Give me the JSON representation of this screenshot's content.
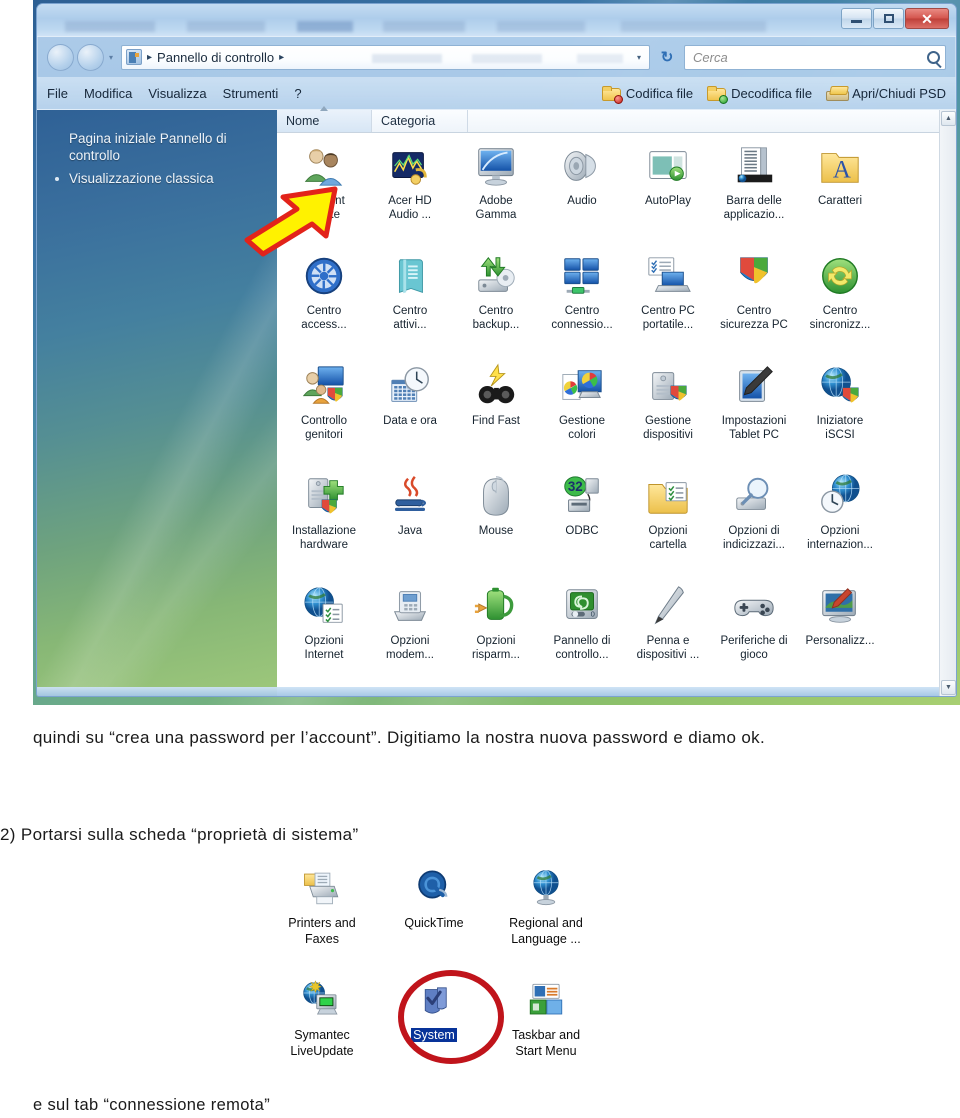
{
  "document": {
    "paragraph_1": "quindi su “crea una password per l’account”. Digitiamo la nostra nuova password e diamo ok.",
    "paragraph_2": "2) Portarsi sulla scheda “proprietà di sistema”",
    "paragraph_3": "e sul tab “connessione remota”"
  },
  "control_panel_window": {
    "window_buttons": {
      "minimize": "—",
      "maximize": "□",
      "close": "✕"
    },
    "address_bar": {
      "breadcrumb_root": "Pannello di controllo",
      "separator": "▸",
      "dropdown_caret": "▾",
      "refresh_label": "↻"
    },
    "search": {
      "placeholder": "Cerca"
    },
    "menu_items": [
      "File",
      "Modifica",
      "Visualizza",
      "Strumenti",
      "?"
    ],
    "toolbar_buttons": [
      {
        "label": "Codifica file",
        "icon": "folder-red-dot-icon"
      },
      {
        "label": "Decodifica file",
        "icon": "folder-green-dot-icon"
      },
      {
        "label": "Apri/Chiudi PSD",
        "icon": "psd-file-icon"
      }
    ],
    "nav_pane": {
      "links": [
        {
          "label": "Pagina iniziale Pannello di controllo",
          "bulleted": false
        },
        {
          "label": "Visualizzazione classica",
          "bulleted": true
        }
      ]
    },
    "columns": [
      {
        "label": "Nome",
        "sorted": true
      },
      {
        "label": "Categoria",
        "sorted": false
      }
    ],
    "items": [
      {
        "label": "Account\nutente",
        "icon": "user-accounts-icon"
      },
      {
        "label": "Acer HD\nAudio ...",
        "icon": "acer-hd-audio-icon"
      },
      {
        "label": "Adobe\nGamma",
        "icon": "adobe-gamma-icon"
      },
      {
        "label": "Audio",
        "icon": "speaker-icon"
      },
      {
        "label": "AutoPlay",
        "icon": "autoplay-icon"
      },
      {
        "label": "Barra delle\napplicazio...",
        "icon": "taskbar-icon"
      },
      {
        "label": "Caratteri",
        "icon": "fonts-folder-icon"
      },
      {
        "label": "Centro\naccess...",
        "icon": "ease-of-access-icon"
      },
      {
        "label": "Centro\nattivi...",
        "icon": "welcome-center-icon"
      },
      {
        "label": "Centro\nbackup...",
        "icon": "backup-center-icon"
      },
      {
        "label": "Centro\nconnessio...",
        "icon": "network-center-icon"
      },
      {
        "label": "Centro PC\nportatile...",
        "icon": "mobility-center-icon"
      },
      {
        "label": "Centro\nsicurezza PC",
        "icon": "security-shield-icon"
      },
      {
        "label": "Centro\nsincronizz...",
        "icon": "sync-center-icon"
      },
      {
        "label": "Controllo\ngenitori",
        "icon": "parental-controls-icon"
      },
      {
        "label": "Data e ora",
        "icon": "date-time-icon"
      },
      {
        "label": "Find Fast",
        "icon": "find-fast-icon"
      },
      {
        "label": "Gestione\ncolori",
        "icon": "color-management-icon"
      },
      {
        "label": "Gestione\ndispositivi",
        "icon": "device-manager-icon"
      },
      {
        "label": "Impostazioni\nTablet PC",
        "icon": "tablet-pc-icon"
      },
      {
        "label": "Iniziatore\niSCSI",
        "icon": "iscsi-initiator-icon"
      },
      {
        "label": "Installazione\nhardware",
        "icon": "add-hardware-icon"
      },
      {
        "label": "Java",
        "icon": "java-icon"
      },
      {
        "label": "Mouse",
        "icon": "mouse-icon"
      },
      {
        "label": "ODBC",
        "icon": "odbc-icon"
      },
      {
        "label": "Opzioni\ncartella",
        "icon": "folder-options-icon"
      },
      {
        "label": "Opzioni di\nindicizzazi...",
        "icon": "indexing-options-icon"
      },
      {
        "label": "Opzioni\ninternazion...",
        "icon": "regional-options-icon"
      },
      {
        "label": "Opzioni\nInternet",
        "icon": "internet-options-icon"
      },
      {
        "label": "Opzioni\nmodem...",
        "icon": "modem-options-icon"
      },
      {
        "label": "Opzioni\nrisparm...",
        "icon": "power-options-icon"
      },
      {
        "label": "Pannello di\ncontrollo...",
        "icon": "nvidia-control-panel-icon"
      },
      {
        "label": "Penna e\ndispositivi ...",
        "icon": "pen-input-icon"
      },
      {
        "label": "Periferiche di\ngioco",
        "icon": "game-controllers-icon"
      },
      {
        "label": "Personalizz...",
        "icon": "personalization-icon"
      }
    ],
    "scrollbar": {
      "up": "▲",
      "down": "▼"
    },
    "annotation": {
      "type": "yellow-arrow",
      "color": "#fff200",
      "outline": "#e2231a"
    }
  },
  "classic_icons_screenshot": {
    "items": [
      {
        "label": "Printers and\nFaxes",
        "icon": "printers-and-faxes-icon",
        "selected": false
      },
      {
        "label": "QuickTime",
        "icon": "quicktime-icon",
        "selected": false
      },
      {
        "label": "Regional and\nLanguage ...",
        "icon": "regional-and-language-icon",
        "selected": false
      },
      {
        "label": "Symantec\nLiveUpdate",
        "icon": "symantec-liveupdate-icon",
        "selected": false
      },
      {
        "label": "System",
        "icon": "system-icon",
        "selected": true
      },
      {
        "label": "Taskbar and\nStart Menu",
        "icon": "taskbar-and-start-menu-icon",
        "selected": false
      }
    ],
    "annotation": {
      "type": "red-circle",
      "color": "#c0141b",
      "target": "System"
    }
  }
}
